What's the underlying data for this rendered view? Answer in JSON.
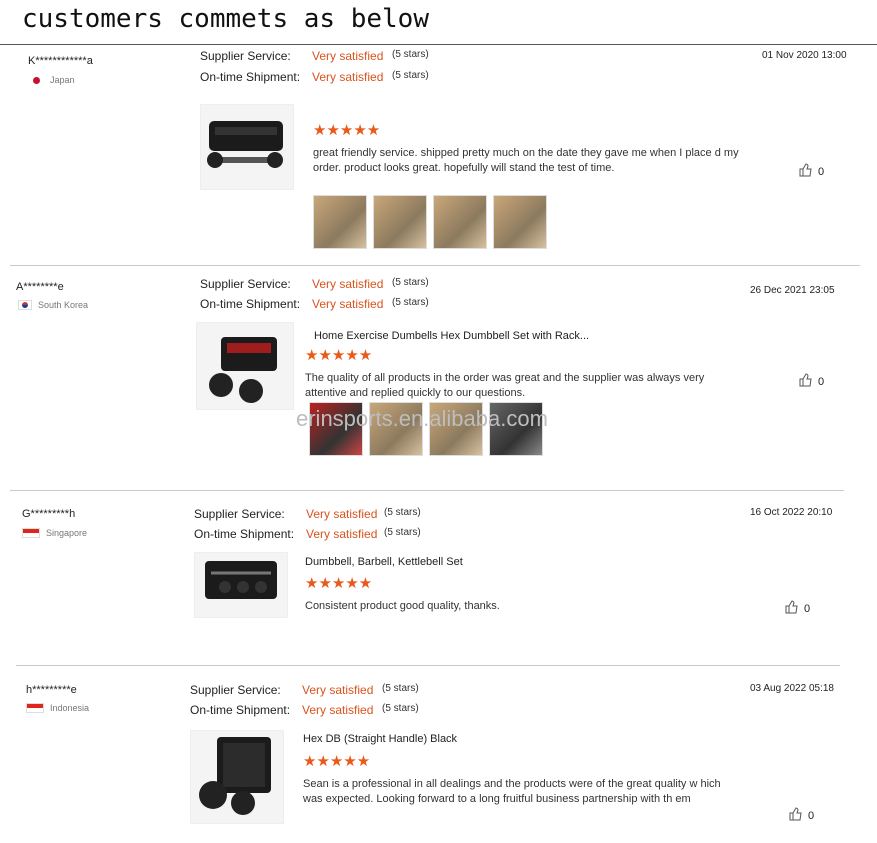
{
  "page": {
    "title": "customers commets as below",
    "watermark": "erinsports.en.alibaba.com"
  },
  "labels": {
    "supplier_service": "Supplier Service:",
    "ontime_shipment": "On-time Shipment:"
  },
  "reviews": [
    {
      "buyer": "K************a",
      "country": "Japan",
      "flag": "jp",
      "supplier_service": "Very satisfied",
      "supplier_stars": "(5 stars)",
      "shipment": "Very satisfied",
      "shipment_stars": "(5 stars)",
      "date": "01 Nov 2020 13:00",
      "product_title": "",
      "stars": "★★★★★",
      "comment": "great friendly service. shipped pretty much on the date they gave me when I place d my order. product looks great. hopefully will stand the test of time.",
      "likes": "0",
      "photos": 4
    },
    {
      "buyer": "A********e",
      "country": "South Korea",
      "flag": "kr",
      "supplier_service": "Very satisfied",
      "supplier_stars": "(5 stars)",
      "shipment": "Very satisfied",
      "shipment_stars": "(5 stars)",
      "date": "26 Dec 2021 23:05",
      "product_title": "Home Exercise Dumbells Hex Dumbbell Set with Rack...",
      "stars": "★★★★★",
      "comment": "The quality of all products in the order was great and the supplier was always very attentive and replied quickly to our questions.",
      "likes": "0",
      "photos": 4
    },
    {
      "buyer": "G*********h",
      "country": "Singapore",
      "flag": "sg",
      "supplier_service": "Very satisfied",
      "supplier_stars": "(5 stars)",
      "shipment": "Very satisfied",
      "shipment_stars": "(5 stars)",
      "date": "16 Oct 2022 20:10",
      "product_title": "Dumbbell, Barbell, Kettlebell Set",
      "stars": "★★★★★",
      "comment": "Consistent product good quality, thanks.",
      "likes": "0",
      "photos": 0
    },
    {
      "buyer": "h*********e",
      "country": "Indonesia",
      "flag": "id",
      "supplier_service": "Very satisfied",
      "supplier_stars": "(5 stars)",
      "shipment": "Very satisfied",
      "shipment_stars": "(5 stars)",
      "date": "03 Aug 2022 05:18",
      "product_title": "Hex DB (Straight Handle) Black",
      "stars": "★★★★★",
      "comment": "Sean is a professional in all dealings and the products were of the great quality w hich was expected. Looking forward to a long fruitful business partnership with th em",
      "likes": "0",
      "photos": 0
    }
  ]
}
